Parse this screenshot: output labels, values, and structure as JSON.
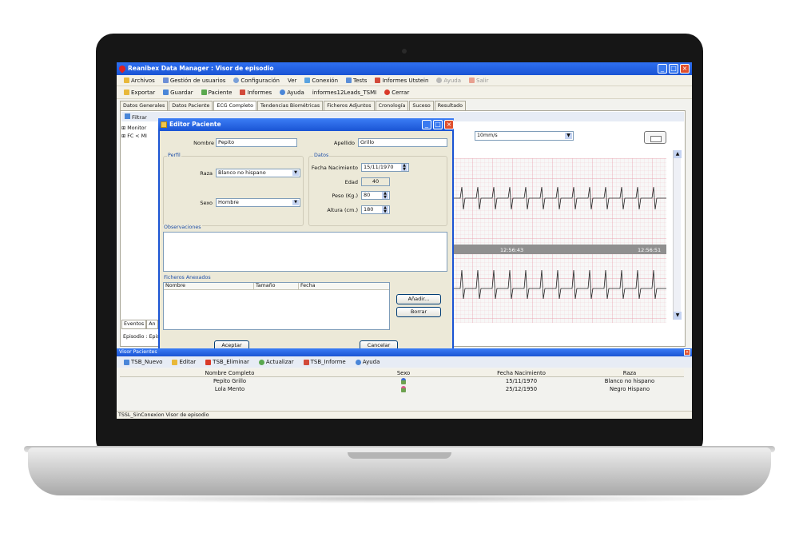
{
  "app": {
    "title": "Reanibex Data Manager : Visor de episodio",
    "menu": [
      {
        "label": "Archivos",
        "icon": "folder-icon",
        "enabled": true
      },
      {
        "label": "Gestión de usuarios",
        "icon": "users-icon",
        "enabled": true
      },
      {
        "label": "Configuración",
        "icon": "settings-icon",
        "enabled": true
      },
      {
        "label": "Ver",
        "icon": "",
        "enabled": true
      },
      {
        "label": "Conexión",
        "icon": "connection-icon",
        "enabled": true
      },
      {
        "label": "Tests",
        "icon": "tests-icon",
        "enabled": true
      },
      {
        "label": "Informes Utstein",
        "icon": "report-icon",
        "enabled": true
      },
      {
        "label": "Ayuda",
        "icon": "help-icon",
        "enabled": false
      },
      {
        "label": "Salir",
        "icon": "exit-icon",
        "enabled": false
      }
    ],
    "toolbar": [
      {
        "label": "Exportar",
        "icon": "export-icon"
      },
      {
        "label": "Guardar",
        "icon": "save-icon"
      },
      {
        "label": "Paciente",
        "icon": "patient-icon"
      },
      {
        "label": "Informes",
        "icon": "report-icon"
      },
      {
        "label": "Ayuda",
        "icon": "help-icon"
      },
      {
        "label": "informes12Leads_TSMI",
        "icon": ""
      },
      {
        "label": "Cerrar",
        "icon": "close-icon"
      }
    ],
    "tabs": [
      "Datos Generales",
      "Datos Paciente",
      "ECG Completo",
      "Tendencias Biométricas",
      "Ficheros Adjuntos",
      "Cronología",
      "Suceso",
      "Resultado"
    ],
    "active_tab": "ECG Completo",
    "subtoolbar": {
      "filter": "Filtrar"
    },
    "tree": [
      "Monitor",
      "FC < MI"
    ],
    "left_tabs": [
      "Eventos",
      "An"
    ],
    "episode_label": "Episodio : Episo",
    "speed_select": "10mm/s",
    "ecg_times": [
      "12:56:43",
      "12:56:51"
    ]
  },
  "dialog": {
    "title": "Editor Paciente",
    "nombre_label": "Nombre",
    "nombre_value": "Pepito",
    "apellido_label": "Apellido",
    "apellido_value": "Grillo",
    "perfil_label": "Perfil",
    "datos_label": "Datos",
    "raza_label": "Raza",
    "raza_value": "Blanco no hispano",
    "sexo_label": "Sexo",
    "sexo_value": "Hombre",
    "fecha_label": "Fecha Nacimiento",
    "fecha_value": "15/11/1970",
    "edad_label": "Edad",
    "edad_value": "40",
    "peso_label": "Peso (Kg.)",
    "peso_value": "80",
    "altura_label": "Altura (cm.)",
    "altura_value": "180",
    "observaciones_label": "Observaciones",
    "ficheros_label": "Ficheros Anexados",
    "files_columns": [
      "Nombre",
      "Tamaño",
      "Fecha"
    ],
    "add_button": "Añadir...",
    "delete_button": "Borrar",
    "accept_button": "Aceptar",
    "cancel_button": "Cancelar"
  },
  "viewer": {
    "title": "Visor Pacientes",
    "toolbar": [
      {
        "label": "TSB_Nuevo",
        "icon": "new-icon"
      },
      {
        "label": "Editar",
        "icon": "edit-icon"
      },
      {
        "label": "TSB_Eliminar",
        "icon": "delete-icon"
      },
      {
        "label": "Actualizar",
        "icon": "refresh-icon"
      },
      {
        "label": "TSB_Informe",
        "icon": "report-icon"
      },
      {
        "label": "Ayuda",
        "icon": "help-icon"
      }
    ],
    "columns": [
      "Nombre Completo",
      "Sexo",
      "Fecha Nacimiento",
      "Raza"
    ],
    "rows": [
      {
        "nombre": "Pepito Grillo",
        "sexo_icon": "male-icon",
        "fecha": "15/11/1970",
        "raza": "Blanco no hispano"
      },
      {
        "nombre": "Lola Mento",
        "sexo_icon": "female-icon",
        "fecha": "25/12/1950",
        "raza": "Negro Hispano"
      }
    ]
  },
  "status": {
    "text": "TSSL_SinConexion  Visor de episodio"
  }
}
